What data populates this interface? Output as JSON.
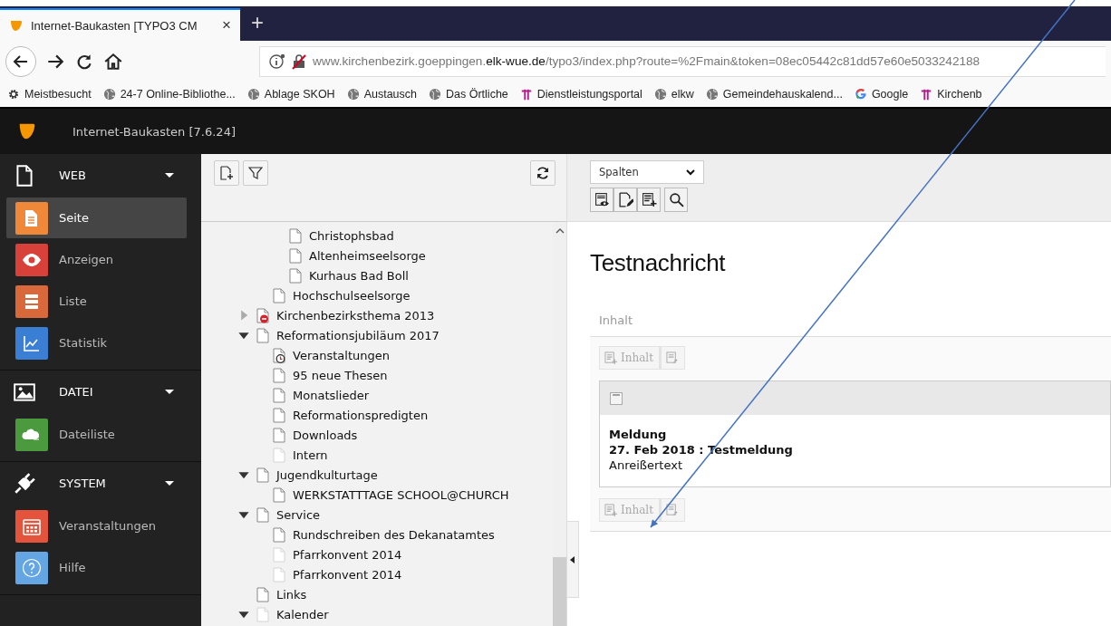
{
  "browser": {
    "tab": {
      "title": "Internet-Baukasten [TYPO3 CM",
      "close": "×"
    },
    "new_tab": "+",
    "url": {
      "prefix": "www.kirchenbezirk.goeppingen.",
      "domain": "elk-wue.de",
      "path": "/typo3/index.php?route=%2Fmain&token=08ec05442c81dd57e60e5033242188"
    },
    "bookmarks": [
      {
        "label": "Meistbesucht",
        "kind": "settings"
      },
      {
        "label": "24-7 Online-Bibliothe...",
        "kind": "globe"
      },
      {
        "label": "Ablage SKOH",
        "kind": "globe"
      },
      {
        "label": "Austausch",
        "kind": "globe"
      },
      {
        "label": "Das Örtliche",
        "kind": "globe"
      },
      {
        "label": "Dienstleistungsportal",
        "kind": "cross"
      },
      {
        "label": "elkw",
        "kind": "globe"
      },
      {
        "label": "Gemeindehauskalend...",
        "kind": "globe"
      },
      {
        "label": "Google",
        "kind": "google"
      },
      {
        "label": "Kirchenb",
        "kind": "cross"
      }
    ]
  },
  "app_title": "Internet-Baukasten [7.6.24]",
  "modules": [
    {
      "title": "WEB",
      "kind": "page",
      "expanded": true,
      "items": [
        {
          "label": "Seite",
          "kind": "page",
          "color": "#f0883a",
          "selected": true
        },
        {
          "label": "Anzeigen",
          "kind": "eye",
          "color": "#d8413a",
          "selected": false
        },
        {
          "label": "Liste",
          "kind": "list",
          "color": "#d9693a",
          "selected": false
        },
        {
          "label": "Statistik",
          "kind": "chart",
          "color": "#3b7fd4",
          "selected": false
        }
      ]
    },
    {
      "title": "DATEI",
      "kind": "image",
      "expanded": true,
      "items": [
        {
          "label": "Dateiliste",
          "kind": "cloud",
          "color": "#4b9a3e",
          "selected": false
        }
      ]
    },
    {
      "title": "SYSTEM",
      "kind": "plug",
      "expanded": true,
      "items": [
        {
          "label": "Veranstaltungen",
          "kind": "calendar",
          "color": "#e4533b",
          "selected": false
        },
        {
          "label": "Hilfe",
          "kind": "help",
          "color": "#64a6e4",
          "selected": false
        }
      ]
    }
  ],
  "tree": {
    "nodes": [
      {
        "children": [
          {
            "children": [
              {
                "label": "Christophsbad",
                "kind": "page",
                "hidden": false
              },
              {
                "label": "Altenheimseelsorge",
                "kind": "page",
                "hidden": false
              },
              {
                "label": "Kurhaus Bad Boll",
                "kind": "page",
                "hidden": false
              }
            ]
          },
          {
            "label": "Hochschulseelsorge",
            "kind": "page",
            "hidden": false
          }
        ]
      },
      {
        "label": "Kirchenbezirksthema 2013",
        "kind": "blocked",
        "hidden": false,
        "expanded": false
      },
      {
        "label": "Reformationsjubiläum 2017",
        "kind": "page",
        "hidden": false,
        "expanded": true,
        "children": [
          {
            "label": "Veranstaltungen",
            "kind": "timed",
            "hidden": false
          },
          {
            "label": "95 neue Thesen",
            "kind": "page",
            "hidden": false
          },
          {
            "label": "Monatslieder",
            "kind": "page",
            "hidden": false
          },
          {
            "label": "Reformationspredigten",
            "kind": "page",
            "hidden": false
          },
          {
            "label": "Downloads",
            "kind": "page",
            "hidden": false
          },
          {
            "label": "Intern",
            "kind": "page",
            "hidden": true
          }
        ]
      },
      {
        "label": "Jugendkulturtage",
        "kind": "page",
        "hidden": false,
        "expanded": true,
        "children": [
          {
            "label": "WERKSTATTTAGE SCHOOL@CHURCH",
            "kind": "page",
            "hidden": false
          }
        ]
      },
      {
        "label": "Service",
        "kind": "page",
        "hidden": false,
        "expanded": true,
        "children": [
          {
            "label": "Rundschreiben des Dekanatamtes",
            "kind": "page",
            "hidden": false
          },
          {
            "label": "Pfarrkonvent 2014",
            "kind": "page",
            "hidden": true
          },
          {
            "label": "Pfarrkonvent 2014",
            "kind": "page",
            "hidden": true
          }
        ]
      },
      {
        "label": "Links",
        "kind": "page",
        "hidden": false
      },
      {
        "label": "Kalender",
        "kind": "page",
        "hidden": true,
        "expanded": true
      }
    ]
  },
  "content": {
    "view_select": "Spalten",
    "page_title": "Testnachricht",
    "column": {
      "title": "Inhalt",
      "new_button": "Inhalt",
      "elements": [
        {
          "type_label": "Meldung",
          "headline": "27. Feb 2018 : Testmeldung",
          "teaser": "Anreißertext",
          "new_button": "Inhalt"
        }
      ]
    }
  }
}
